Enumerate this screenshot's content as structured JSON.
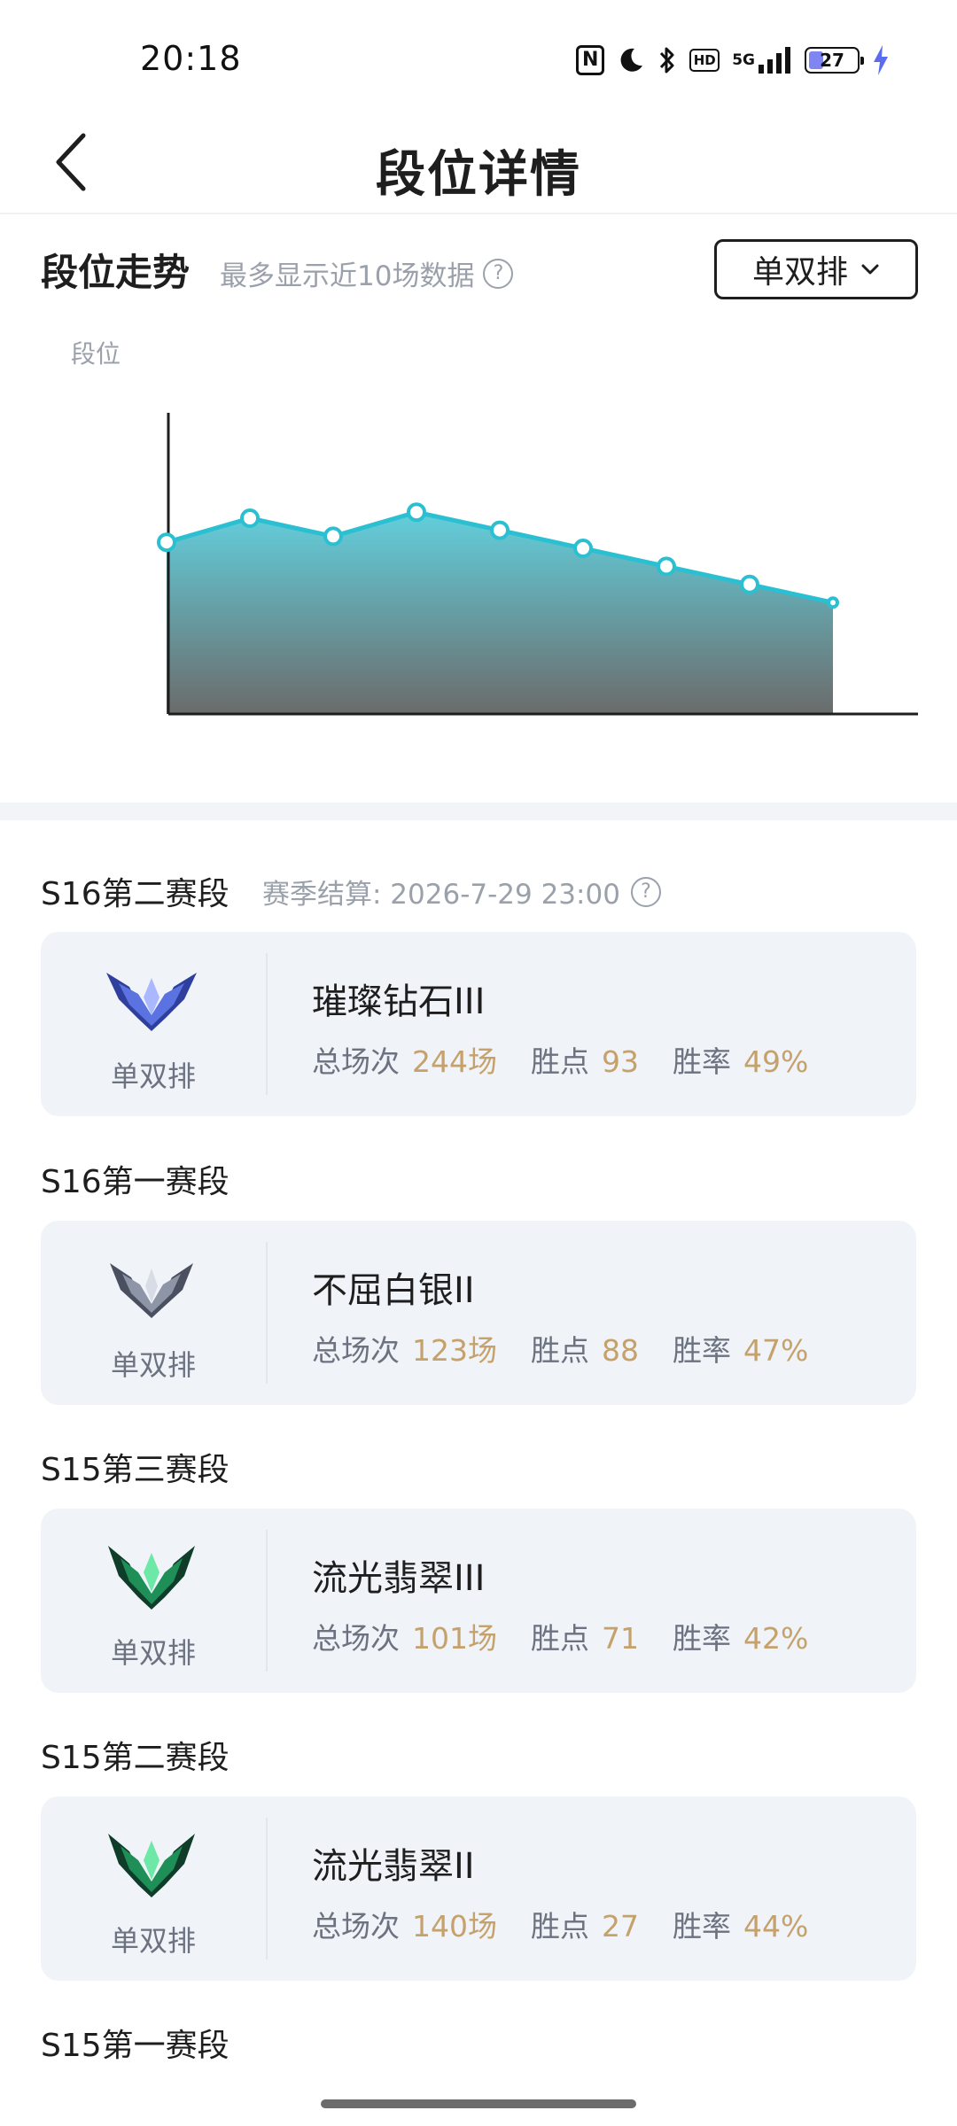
{
  "status_bar": {
    "time": "20:18",
    "network": "5G",
    "hd_label": "HD",
    "battery": "27",
    "icons": [
      "nfc-icon",
      "moon-icon",
      "bluetooth-icon",
      "hd-icon",
      "5g-signal-icon",
      "battery-icon",
      "charging-icon"
    ]
  },
  "header": {
    "title": "段位详情",
    "back_icon": "chevron-left-icon"
  },
  "trend": {
    "title": "段位走势",
    "subtitle": "最多显示近10场数据",
    "help_icon": "question-circle-icon",
    "mode_select": {
      "selected": "单双排",
      "icon": "chevron-down-icon"
    },
    "y_axis_label": "段位"
  },
  "chart_data": {
    "type": "area",
    "title": "",
    "xlabel": "",
    "ylabel": "段位",
    "x": [
      1,
      2,
      3,
      4,
      5,
      6,
      7,
      8,
      9
    ],
    "values": [
      0.57,
      0.65,
      0.59,
      0.67,
      0.61,
      0.55,
      0.49,
      0.43,
      0.37
    ],
    "ylim": [
      0,
      1
    ],
    "line_color": "#2bbfd2",
    "fill_top_color": "#62cfdc",
    "fill_bottom_color": "#6b6b6b",
    "grid": false,
    "legend": "none"
  },
  "seasons": [
    {
      "label": "S16第二赛段",
      "settle": "赛季结算: 2026-7-29 23:00",
      "queue": "单双排",
      "rank": "璀璨钻石III",
      "emblem": "diamond-emblem-icon",
      "emblem_color": "#4a5fd0",
      "stats": {
        "games_label": "总场次",
        "games": "244场",
        "points_label": "胜点",
        "points": "93",
        "winrate_label": "胜率",
        "winrate": "49%"
      }
    },
    {
      "label": "S16第一赛段",
      "queue": "单双排",
      "rank": "不屈白银II",
      "emblem": "silver-emblem-icon",
      "emblem_color": "#7d8596",
      "stats": {
        "games_label": "总场次",
        "games": "123场",
        "points_label": "胜点",
        "points": "88",
        "winrate_label": "胜率",
        "winrate": "47%"
      }
    },
    {
      "label": "S15第三赛段",
      "queue": "单双排",
      "rank": "流光翡翠III",
      "emblem": "emerald-emblem-icon",
      "emblem_color": "#2aa56a",
      "stats": {
        "games_label": "总场次",
        "games": "101场",
        "points_label": "胜点",
        "points": "71",
        "winrate_label": "胜率",
        "winrate": "42%"
      }
    },
    {
      "label": "S15第二赛段",
      "queue": "单双排",
      "rank": "流光翡翠II",
      "emblem": "emerald-emblem-icon",
      "emblem_color": "#2aa56a",
      "stats": {
        "games_label": "总场次",
        "games": "140场",
        "points_label": "胜点",
        "points": "27",
        "winrate_label": "胜率",
        "winrate": "44%"
      }
    },
    {
      "label": "S15第一赛段"
    }
  ],
  "colors": {
    "accent_gold": "#c5a16b",
    "muted_text": "#9aa1ab",
    "card_bg": "#f0f3f8"
  }
}
